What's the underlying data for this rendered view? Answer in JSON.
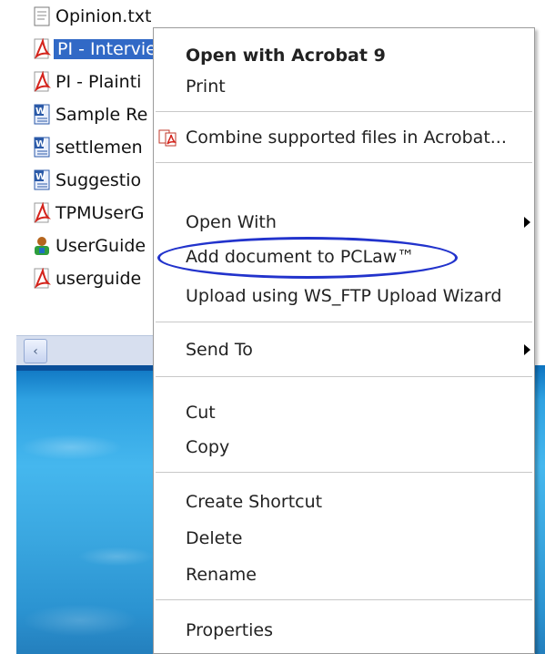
{
  "explorer": {
    "files": [
      {
        "name": "Opinion.txt",
        "icon": "text-file-icon",
        "selected": false
      },
      {
        "name": "PI - Interview.pdf",
        "icon": "pdf-file-icon",
        "selected": true
      },
      {
        "name": "PI - Plainti",
        "icon": "pdf-file-icon",
        "selected": false
      },
      {
        "name": "Sample Re",
        "icon": "word-file-icon",
        "selected": false
      },
      {
        "name": "settlemen",
        "icon": "word-file-icon",
        "selected": false
      },
      {
        "name": "Suggestio",
        "icon": "word-file-icon",
        "selected": false
      },
      {
        "name": "TPMUserG",
        "icon": "pdf-file-icon",
        "selected": false
      },
      {
        "name": "UserGuide",
        "icon": "user-file-icon",
        "selected": false
      },
      {
        "name": "userguide",
        "icon": "pdf-file-icon",
        "selected": false
      }
    ],
    "scroll_left_glyph": "‹"
  },
  "context_menu": {
    "open_with_acrobat": "Open with Acrobat 9",
    "print": "Print",
    "combine": "Combine supported files in Acrobat...",
    "open_with": "Open With",
    "add_document": "Add document to PCLaw™",
    "upload": "Upload using WS_FTP Upload Wizard",
    "send_to": "Send To",
    "cut": "Cut",
    "copy": "Copy",
    "create_shortcut": "Create Shortcut",
    "delete": "Delete",
    "rename": "Rename",
    "properties": "Properties"
  },
  "colors": {
    "selection": "#3169c6",
    "highlight_oval": "#2233cc",
    "pdf_red": "#d4241c",
    "word_blue": "#2b5aa8"
  }
}
